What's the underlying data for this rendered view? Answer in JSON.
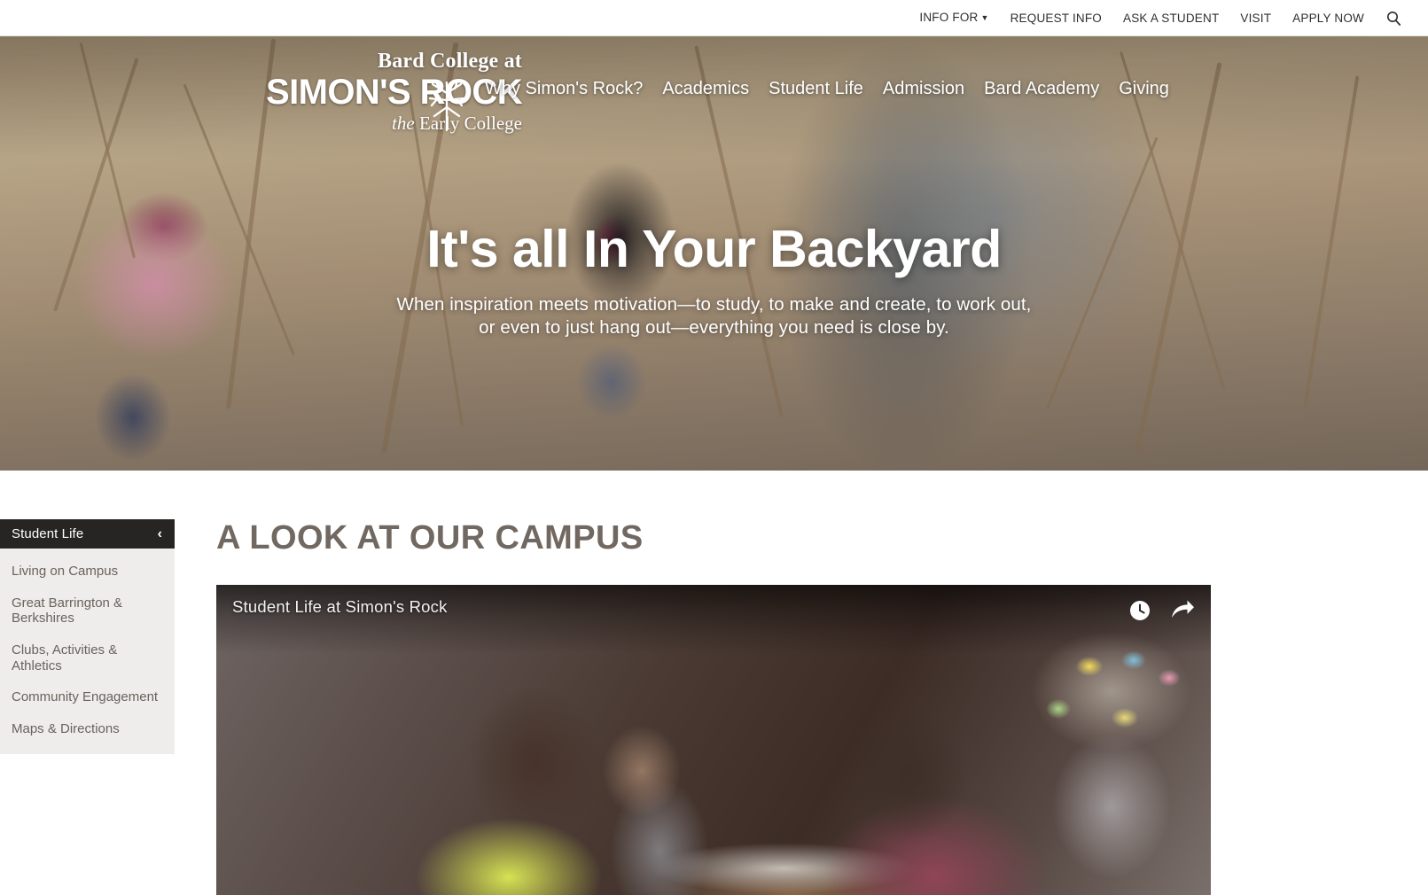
{
  "utility": {
    "links": [
      {
        "label": "INFO FOR",
        "caret": "▼",
        "has_caret": true
      },
      {
        "label": "REQUEST INFO",
        "has_caret": false
      },
      {
        "label": "ASK A STUDENT",
        "has_caret": false
      },
      {
        "label": "VISIT",
        "has_caret": false
      },
      {
        "label": "APPLY NOW",
        "has_caret": false
      }
    ],
    "search_icon": "search-icon"
  },
  "logo": {
    "line1": "Bard College at",
    "line2": "SIMON'S ROCK",
    "line3_italic": "the",
    "line3_rest": " Early College",
    "mark": "snowflake-tree-emblem"
  },
  "main_nav": {
    "items": [
      {
        "label": "Why Simon's Rock?"
      },
      {
        "label": "Academics"
      },
      {
        "label": "Student Life"
      },
      {
        "label": "Admission"
      },
      {
        "label": "Bard Academy"
      },
      {
        "label": "Giving"
      }
    ]
  },
  "hero": {
    "title": "It's all In Your Backyard",
    "subtitle": "When inspiration meets motivation—to study, to make and create, to work out, or even to just hang out—everything you need is close by."
  },
  "sidebar": {
    "header": {
      "label": "Student Life",
      "chevron": "‹"
    },
    "items": [
      {
        "label": "Living on Campus"
      },
      {
        "label": "Great Barrington & Berkshires"
      },
      {
        "label": "Clubs, Activities & Athletics"
      },
      {
        "label": "Community Engagement"
      },
      {
        "label": "Maps & Directions"
      }
    ]
  },
  "main": {
    "section_title": "A look at our campus",
    "video": {
      "title": "Student Life at Simon's Rock",
      "watch_later_icon": "clock-icon",
      "share_icon": "share-arrow-icon"
    }
  },
  "colors": {
    "dark": "#272523",
    "sidebar_bg": "#eeedeb",
    "sidebar_text": "#6b625c",
    "heading": "#716961",
    "utility_text": "#2f2f2f",
    "white": "#ffffff"
  }
}
